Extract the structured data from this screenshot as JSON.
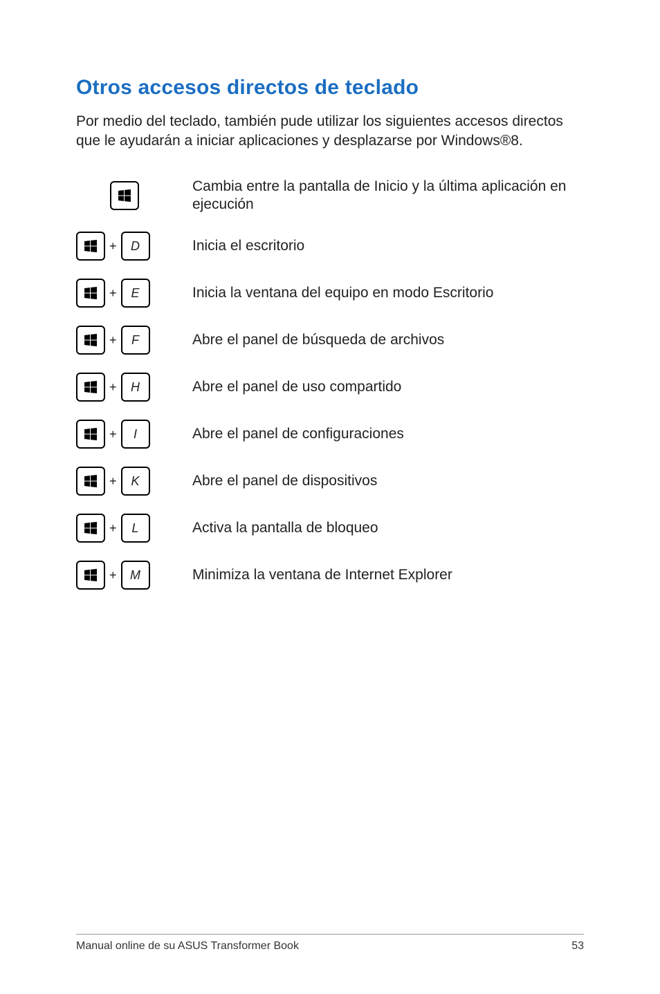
{
  "title": "Otros accesos directos de teclado",
  "intro": "Por medio del teclado, también pude utilizar los siguientes accesos directos que le ayudarán a iniciar aplicaciones y desplazarse por Windows®8.",
  "plus": "+",
  "shortcuts": [
    {
      "keys": [
        "win"
      ],
      "desc": "Cambia entre la pantalla de Inicio y la última aplicación en ejecución"
    },
    {
      "keys": [
        "win",
        "D"
      ],
      "desc": "Inicia el escritorio"
    },
    {
      "keys": [
        "win",
        "E"
      ],
      "desc": "Inicia la ventana del equipo en modo Escritorio"
    },
    {
      "keys": [
        "win",
        "F"
      ],
      "desc": "Abre el panel de búsqueda de archivos"
    },
    {
      "keys": [
        "win",
        "H"
      ],
      "desc": "Abre el panel de uso compartido"
    },
    {
      "keys": [
        "win",
        "I"
      ],
      "desc": "Abre el panel de configuraciones"
    },
    {
      "keys": [
        "win",
        "K"
      ],
      "desc": "Abre el panel de dispositivos"
    },
    {
      "keys": [
        "win",
        "L"
      ],
      "desc": "Activa la pantalla de bloqueo"
    },
    {
      "keys": [
        "win",
        "M"
      ],
      "desc": "Minimiza la ventana de Internet Explorer"
    }
  ],
  "footer": {
    "left": "Manual online de su ASUS Transformer Book",
    "right": "53"
  }
}
